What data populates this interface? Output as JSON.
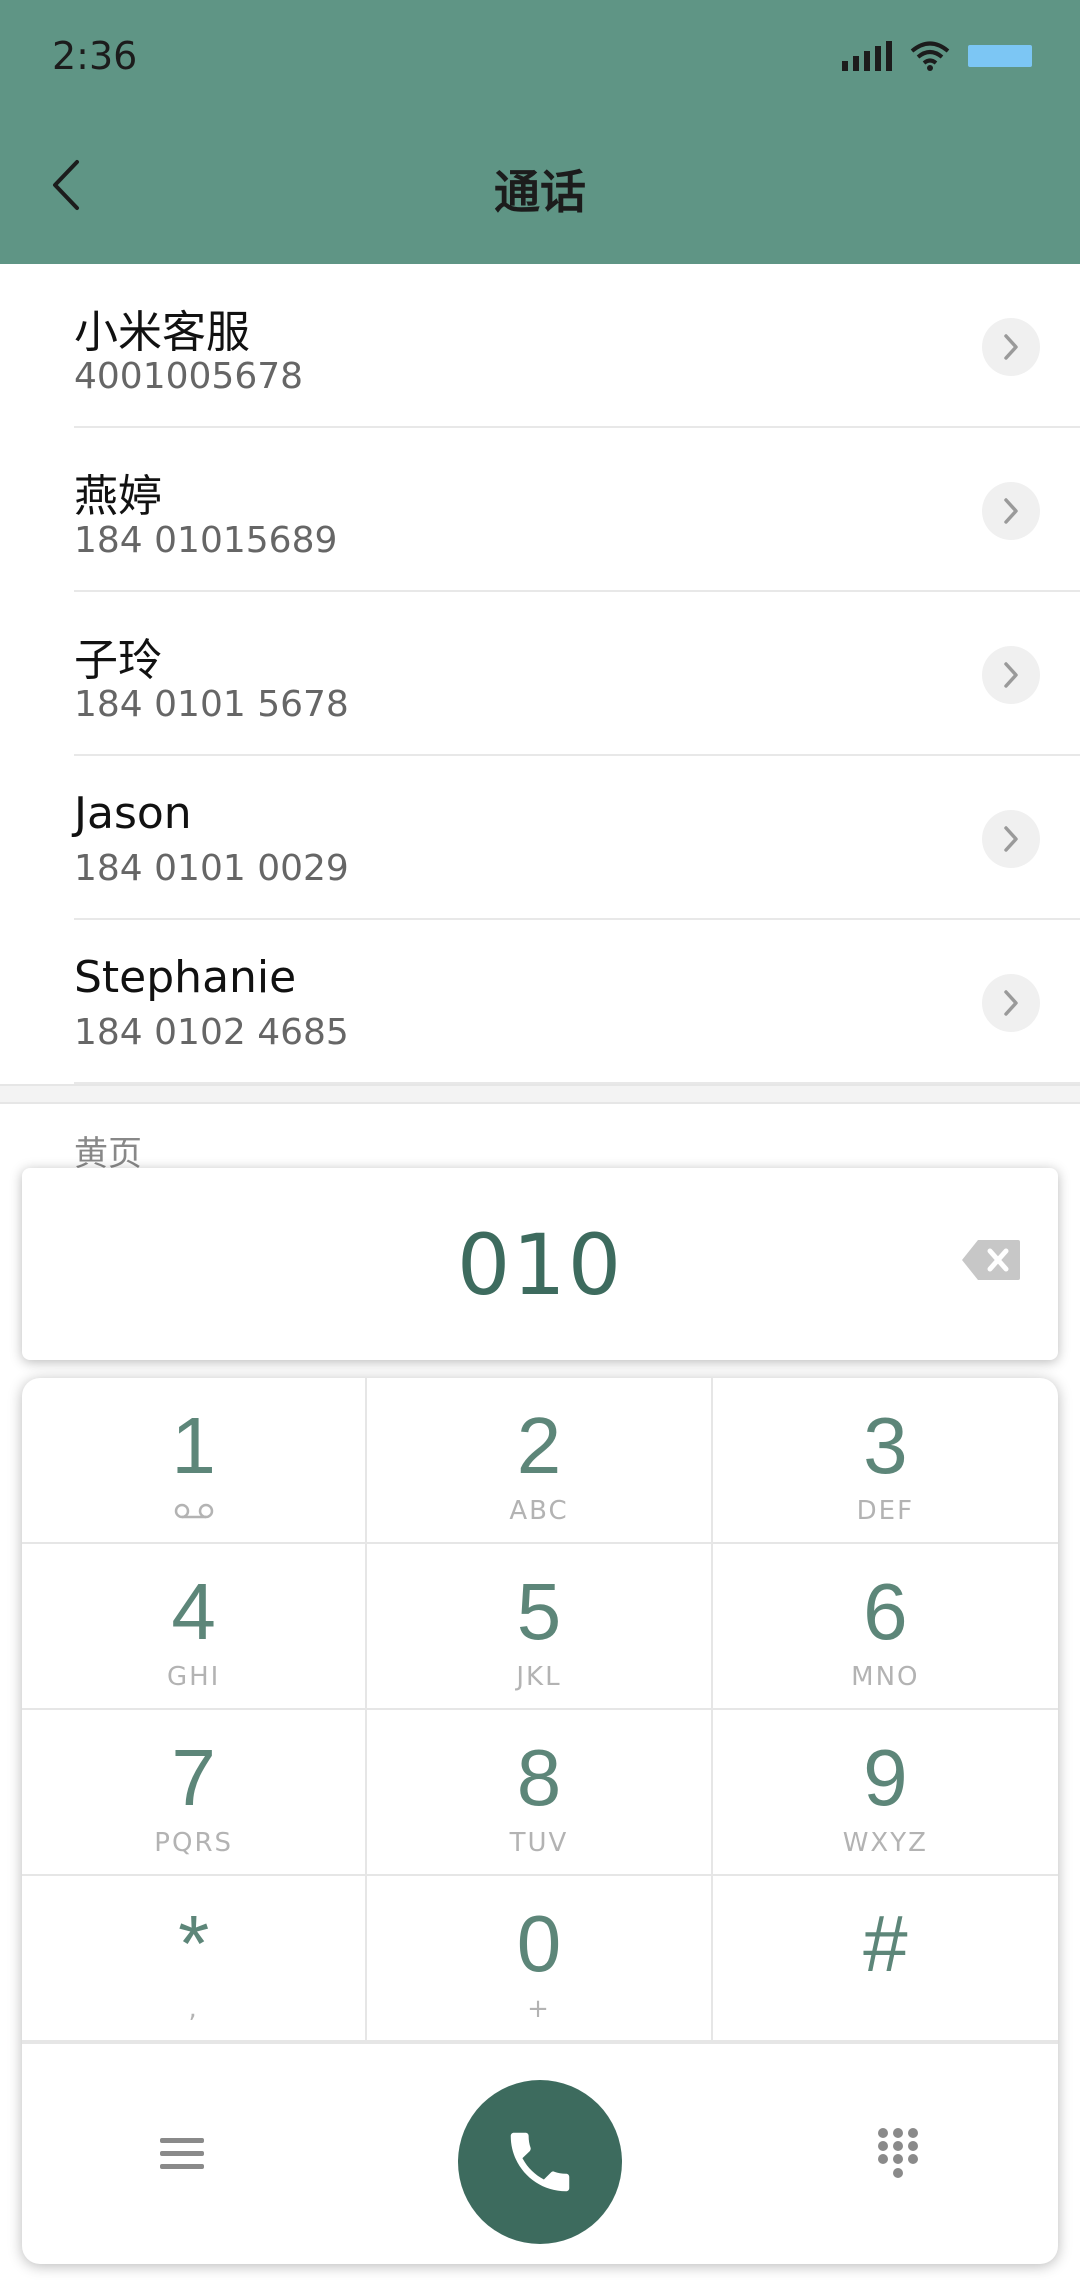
{
  "status_bar": {
    "time": "2:36"
  },
  "header": {
    "title": "通话"
  },
  "contacts": [
    {
      "name": "小米客服",
      "number": "4001005678"
    },
    {
      "name": "燕婷",
      "number": "184 01015689"
    },
    {
      "name": "子玲",
      "number": "184 0101 5678"
    },
    {
      "name": "Jason",
      "number": "184 0101 0029"
    },
    {
      "name": "Stephanie",
      "number": "184 0102 4685"
    }
  ],
  "section": {
    "label": "黄页"
  },
  "dialer": {
    "input": "010"
  },
  "keypad": [
    {
      "digit": "1",
      "letters": ""
    },
    {
      "digit": "2",
      "letters": "ABC"
    },
    {
      "digit": "3",
      "letters": "DEF"
    },
    {
      "digit": "4",
      "letters": "GHI"
    },
    {
      "digit": "5",
      "letters": "JKL"
    },
    {
      "digit": "6",
      "letters": "MNO"
    },
    {
      "digit": "7",
      "letters": "PQRS"
    },
    {
      "digit": "8",
      "letters": "TUV"
    },
    {
      "digit": "9",
      "letters": "WXYZ"
    },
    {
      "digit": "*",
      "letters": ","
    },
    {
      "digit": "0",
      "letters": "+"
    },
    {
      "digit": "#",
      "letters": ""
    }
  ],
  "colors": {
    "header_bg": "#5f9585",
    "accent": "#3d6b5e",
    "key_digit": "#5d8679",
    "battery": "#7cc6f4"
  },
  "icons": {
    "back": "chevron-left-icon",
    "row_action": "chevron-right-icon",
    "backspace": "backspace-icon",
    "menu": "menu-icon",
    "call": "phone-icon",
    "dialpad": "dialpad-icon",
    "voicemail": "voicemail-icon"
  }
}
